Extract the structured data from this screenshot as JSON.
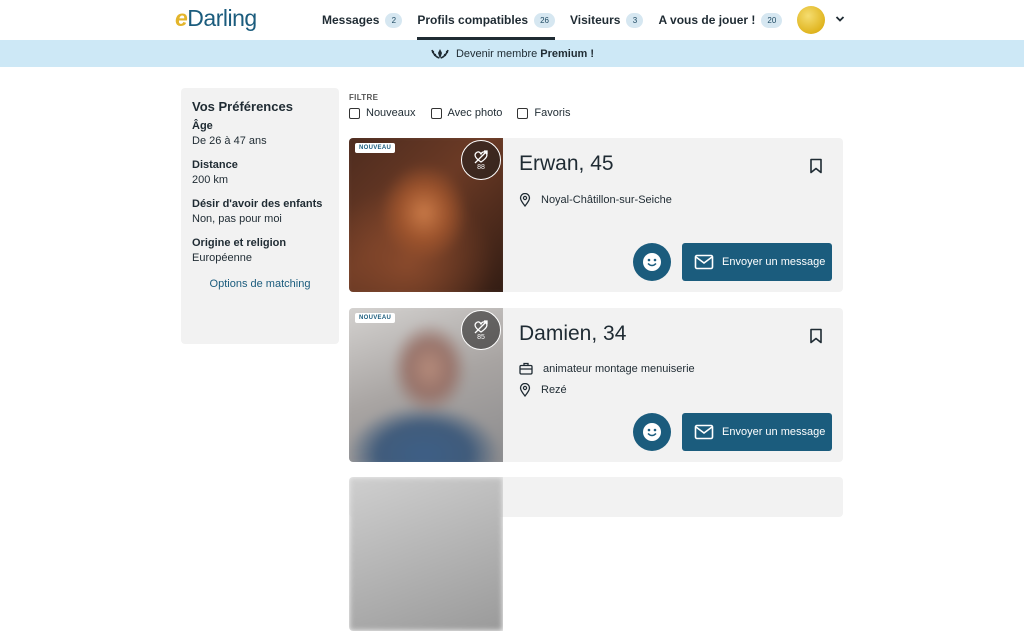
{
  "header": {
    "logo_e": "e",
    "logo_rest": "Darling",
    "nav": [
      {
        "label": "Messages",
        "count": "2"
      },
      {
        "label": "Profils compatibles",
        "count": "26"
      },
      {
        "label": "Visiteurs",
        "count": "3"
      },
      {
        "label": "A vous de jouer !",
        "count": "20"
      }
    ],
    "active_tab": "Profils compatibles"
  },
  "premium_bar": {
    "text": "Devenir membre",
    "bold": "Premium !"
  },
  "sidebar": {
    "title": "Vos Préférences",
    "prefs": [
      {
        "key": "Âge",
        "value": "De 26 à 47 ans"
      },
      {
        "key": "Distance",
        "value": "200 km"
      },
      {
        "key": "Désir d'avoir des enfants",
        "value": "Non, pas pour moi"
      },
      {
        "key": "Origine et religion",
        "value": "Européenne"
      }
    ],
    "link": "Options de matching"
  },
  "filters": {
    "label": "FILTRE",
    "options": [
      "Nouveaux",
      "Avec photo",
      "Favoris"
    ]
  },
  "profiles": [
    {
      "name": "Erwan, 45",
      "badge": "NOUVEAU",
      "match": "88",
      "job": "",
      "location": "Noyal-Châtillon-sur-Seiche",
      "message_label": "Envoyer un message"
    },
    {
      "name": "Damien, 34",
      "badge": "NOUVEAU",
      "match": "85",
      "job": "animateur montage menuiserie",
      "location": "Rezé",
      "message_label": "Envoyer un message"
    }
  ],
  "colors": {
    "brand": "#1b5c7d",
    "premium_bar": "#cde8f6",
    "card_bg": "#f2f2f2",
    "logo_accent": "#e3b52b"
  }
}
